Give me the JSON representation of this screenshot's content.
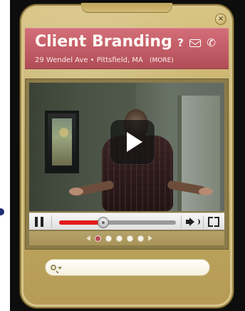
{
  "widget": {
    "close_icon": "close-icon",
    "close_symbol": "×"
  },
  "header": {
    "title": "Client Branding",
    "address": "29 Wendel Ave • Pittsfield, MA",
    "more_label": "(MORE)",
    "help_icon": "help-icon",
    "help_symbol": "?",
    "mail_icon": "mail-icon",
    "phone_icon": "phone-icon",
    "phone_symbol": "✆"
  },
  "player": {
    "play_icon": "play-icon",
    "pause_icon": "pause-icon",
    "volume_icon": "volume-icon",
    "fullscreen_icon": "fullscreen-icon",
    "progress_fraction": 0.38
  },
  "pager": {
    "left_icon": "chevron-left-icon",
    "right_icon": "chevron-right-icon",
    "dots": [
      {
        "active": true
      },
      {
        "active": false
      },
      {
        "active": false
      },
      {
        "active": false
      },
      {
        "active": false
      }
    ]
  },
  "search": {
    "icon": "search-icon",
    "dropdown_icon": "chevron-down-icon",
    "placeholder": "",
    "value": ""
  },
  "colors": {
    "gold": "#c4ad66",
    "header_red": "#b04c56",
    "progress_red": "#e41a1a",
    "active_dot": "#b74a55"
  }
}
